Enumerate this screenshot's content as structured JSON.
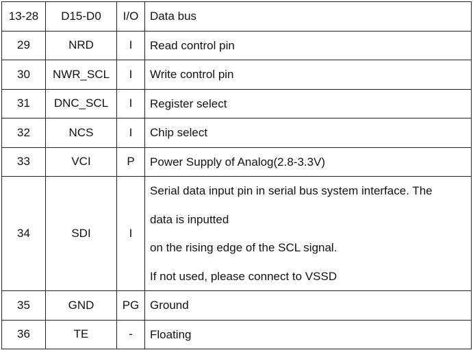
{
  "rows": [
    {
      "no": "13-28",
      "name": "D15-D0",
      "io": "I/O",
      "desc": [
        "Data bus"
      ]
    },
    {
      "no": "29",
      "name": "NRD",
      "io": "I",
      "desc": [
        "Read control pin"
      ]
    },
    {
      "no": "30",
      "name": "NWR_SCL",
      "io": "I",
      "desc": [
        "Write control pin"
      ]
    },
    {
      "no": "31",
      "name": "DNC_SCL",
      "io": "I",
      "desc": [
        "Register select"
      ]
    },
    {
      "no": "32",
      "name": "NCS",
      "io": "I",
      "desc": [
        "Chip select"
      ]
    },
    {
      "no": "33",
      "name": "VCI",
      "io": "P",
      "desc": [
        "Power Supply of Analog(2.8-3.3V)"
      ]
    },
    {
      "no": "34",
      "name": "SDI",
      "io": "I",
      "desc": [
        "Serial data input pin in serial bus system interface. The",
        "data is inputted",
        "on the rising edge of the SCL signal.",
        "If not used, please connect to VSSD"
      ]
    },
    {
      "no": "35",
      "name": "GND",
      "io": "PG",
      "desc": [
        "Ground"
      ]
    },
    {
      "no": "36",
      "name": "TE",
      "io": "-",
      "desc": [
        "Floating"
      ]
    }
  ]
}
